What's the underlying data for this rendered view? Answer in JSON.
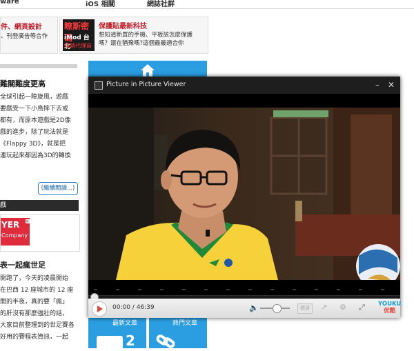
{
  "topbar": {
    "items": [
      "ware",
      "iOS 相關",
      "網誌社群"
    ]
  },
  "ads": {
    "left": {
      "title": "件、網頁設計",
      "text": "、刊登廣告等合作"
    },
    "right": {
      "thumb_lines": [
        "瞭斯密碼",
        "iMod 台北",
        "經銷代理商"
      ],
      "title": "保護貼最新科技",
      "line1": "想知道新買的手機、平板該怎麼保護",
      "line2": "嗎？還在猶豫嗎?這個最最適合你"
    }
  },
  "article1": {
    "title": "難關難度更高",
    "lines": [
      "全球引起一陣旋風，遊戲",
      "要戲受一下小鳥摔下去或",
      "都有，而原本遊戲是2D像",
      "戲的進步，除了玩法就是",
      "《Flappy 3D》，就是把",
      "連玩起來都因為3D的轉換"
    ],
    "read_more": "(繼續閱讀...)"
  },
  "section_bar": "戲",
  "side_ad": {
    "line1": "YER",
    "line2": "Company"
  },
  "article2": {
    "title": "表一起瘋世足",
    "lines": [
      "開跑了，今天的凌晨開始",
      "在巴西 12 座城市的 12 座",
      "間的半夜，真的要「瘋」",
      "的肝沒有那麼強壯的話，",
      "大家目前整理到的世足賽各",
      "好用的賽程表資訊，一起"
    ]
  },
  "tiles": {
    "left_label": "最新文章",
    "right_label": "熱門文章",
    "number": "2"
  },
  "pip": {
    "title": "Picture in Picture Viewer",
    "minimize": "–",
    "close": "✕",
    "time": "00:00 / 46:39",
    "progress": 0,
    "volume": 0.55,
    "hd_label": "標清",
    "brand_top": "YOUKU",
    "brand_bottom": "优酷"
  },
  "colors": {
    "accent": "#2a9ee0",
    "play": "#e2463c",
    "shirt": "#f6d13a",
    "collar": "#1f8a3a"
  }
}
